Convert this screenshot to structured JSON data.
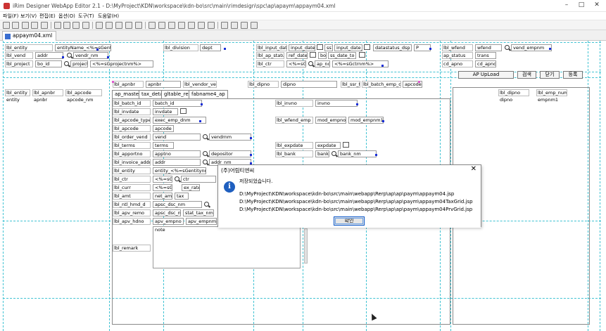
{
  "window": {
    "title": "iRim Designer WebApp Editor 2.1 - D:\\MyProject\\KDN\\workspace\\kdn-bo\\src\\main\\rimdesign\\spc\\ap\\apaym\\appaym04.xml",
    "min_label": "–",
    "max_label": "□",
    "close_label": "✕"
  },
  "menu": [
    "파일(F)",
    "보기(V)",
    "편집(E)",
    "옵션(O)",
    "도구(T)",
    "도움말(H)"
  ],
  "document_tab": "appaym04.xml",
  "buttons": {
    "ap_upload": "AP UpLoad",
    "search": "검색",
    "close": "닫기",
    "register": "등록"
  },
  "tabs": [
    "ap_master",
    "tax_detail",
    "gltable_rec",
    "fabname4_ap"
  ],
  "header_fields": [
    {
      "label": "lbl_entity",
      "value": "entityName_<%=sGentitynm%>"
    },
    {
      "label": "lbl_vend",
      "value": "addr"
    },
    {
      "label": "lbl_project",
      "value": "bo_id"
    },
    {
      "label": "lbl_division",
      "value": "dept"
    },
    {
      "label": "lbl_input_date",
      "value": "input_date_to"
    },
    {
      "label": "lbl_ap_status",
      "value": "ap_status"
    },
    {
      "label": "lbl_wfend",
      "value": "wfend"
    },
    {
      "label": "lbl_ctr",
      "value": "<%=sGctrnm%>"
    }
  ],
  "header_extra": {
    "vend_nm": "vendr_nm",
    "project_nm": "project_nm",
    "project_text": "<%=sGprojectnm%>",
    "division_sel": "dept",
    "input_dt1": "ss1",
    "input_dt2": "input_date_to",
    "ref_date_to": "ref_date_to",
    "status_sel": "datastatus_dsp",
    "status_code": "P",
    "bo_col": "bo_no",
    "ctr_text": "<%=sGctrnm%>",
    "ap_no_text": "ap_no",
    "ap_status_col": "ap_status",
    "vend_tmp": "vend_empnm",
    "cd_apno": "cd_apno",
    "lbl_trans": "trans",
    "lbl_ss": "ss_date_to"
  },
  "grid_header": [
    "lbl_entity",
    "lbl_apnbr",
    "lbl_apcode"
  ],
  "grid_row": [
    "entity",
    "apnbr",
    "apcode_nm"
  ],
  "right_grid_header": [
    "lbl_dipno",
    "lbl_emp_num"
  ],
  "right_grid_row": [
    "dipno",
    "empnm1"
  ],
  "mid_row": {
    "apnbr": "lbl_apnbr",
    "apnbr_val": "apnbr",
    "vendor": "lbl_vendor_vendr",
    "dipno": "lbl_dipno",
    "dipno_val": "dipno",
    "exp": "lbl_ssr_text_emp",
    "exp2": "lbl_batch_emp_dnm",
    "apcode4": "apcode4"
  },
  "form_fields": [
    {
      "label": "lbl_batch_id",
      "value": "batch_id"
    },
    {
      "label": "lbl_invdate",
      "value": "invdate"
    },
    {
      "label": "lbl_apcode_type",
      "value": "exec_emp_dnm"
    },
    {
      "label": "lbl_apcode",
      "value": "apcode"
    },
    {
      "label": "lbl_order_vend",
      "value": "vend"
    },
    {
      "label": "lbl_terms",
      "value": "terms"
    },
    {
      "label": "lbl_apportno",
      "value": "apptno"
    },
    {
      "label": "lbl_invoice_addr",
      "value": "addr"
    },
    {
      "label": "lbl_entity",
      "value": "entity_<%=sGentitynm%>"
    },
    {
      "label": "lbl_ctr",
      "value": "<%=sGctrnm%>"
    },
    {
      "label": "lbl_curr",
      "value": "<%=sG...>"
    },
    {
      "label": "lbl_amt",
      "value": "net_amt"
    },
    {
      "label": "lbl_ntl_hmd_d",
      "value": "apsc_dsc_nm"
    },
    {
      "label": "lbl_apv_remo",
      "value": "apsc_dsc_nm"
    },
    {
      "label": "lbl_apv_hdno",
      "value": "apv_empno"
    },
    {
      "label": "lbl_remark",
      "value": "note"
    }
  ],
  "form_right": [
    {
      "label": "lbl_invno",
      "value": "invno"
    },
    {
      "label": "lbl_wfend_emp",
      "value": "mod_empno"
    },
    {
      "label": "lbl_expdate",
      "value": "expdate"
    },
    {
      "label": "lbl_bank",
      "value": "bank"
    }
  ],
  "form_misc": {
    "mod_empnm1": "mod_empnm1",
    "vendr_nm": "vendrnm",
    "depositor": "depositor",
    "bank_nm": "bank_nm",
    "addr_nm": "addr_nm",
    "rate": "ex_rate",
    "tax": "tax",
    "stat_tax": "stat_tax_nm",
    "apv_empnm": "apv_empnm1",
    "ctr_plus": "ctr",
    "curr_sel": "curr"
  },
  "dialog": {
    "title": "(주)어림티엔씨",
    "message": "저장되었습니다.",
    "paths": [
      "D:\\MyProject\\KDN\\workspace\\kdn-bo\\src\\main\\webapp\\Rerp\\ap\\ap\\paym\\appaym04.jsp",
      "D:\\MyProject\\KDN\\workspace\\kdn-bo\\src\\main\\webapp\\Rerp\\ap\\ap\\paym\\appaym04TaxGrid.jsp",
      "D:\\MyProject\\KDN\\workspace\\kdn-bo\\src\\main\\webapp\\Rerp\\ap\\ap\\paym\\appaym04PrvGrid.jsp"
    ],
    "ok_label": "확인",
    "close_label": "✕",
    "info_glyph": "i"
  },
  "colors": {
    "guide": "#41c3d3",
    "marker": "#1a2fd8",
    "accent": "#0a57c9"
  }
}
